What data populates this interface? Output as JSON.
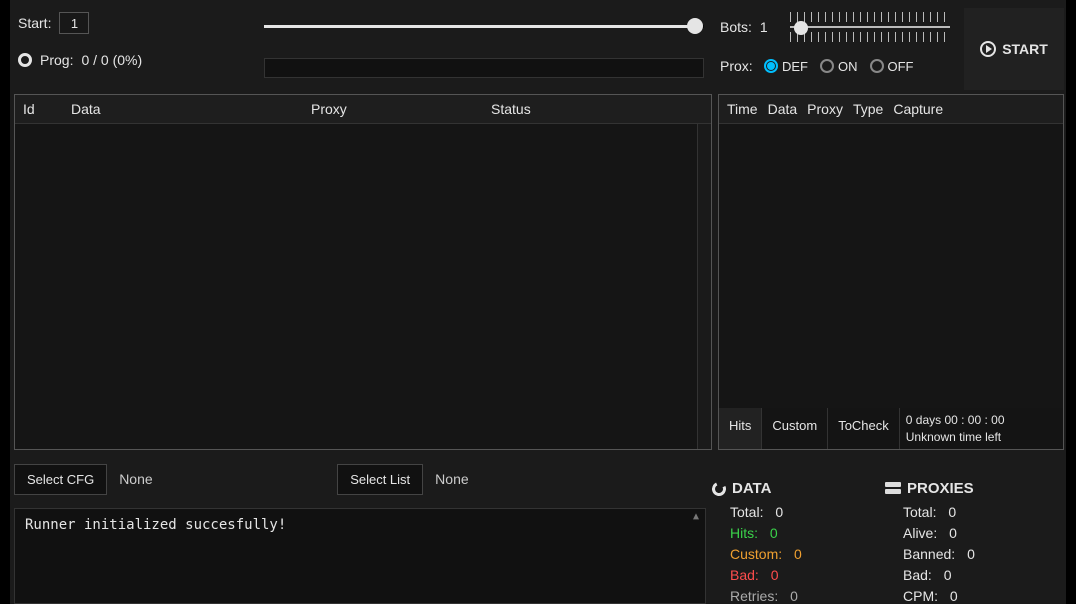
{
  "top": {
    "start_label": "Start:",
    "start_value": "1",
    "prog_label": "Prog:",
    "prog_text": "0 / 0 (0%)",
    "bots_label": "Bots:",
    "bots_value": "1",
    "prox_label": "Prox:",
    "prox_options": {
      "def": "DEF",
      "on": "ON",
      "off": "OFF"
    },
    "prox_selected": "DEF",
    "start_button": "START"
  },
  "left_table": {
    "headers": {
      "id": "Id",
      "data": "Data",
      "proxy": "Proxy",
      "status": "Status"
    },
    "rows": []
  },
  "right_table": {
    "headers": {
      "time": "Time",
      "data": "Data",
      "proxy": "Proxy",
      "type": "Type",
      "capture": "Capture"
    },
    "rows": []
  },
  "tabs": {
    "hits": "Hits",
    "custom": "Custom",
    "tocheck": "ToCheck",
    "timer_line1": "0  days  00 : 00 : 00",
    "timer_line2": "Unknown time left"
  },
  "cfg": {
    "select_cfg_btn": "Select CFG",
    "cfg_value": "None",
    "select_list_btn": "Select List",
    "list_value": "None"
  },
  "log": {
    "lines": [
      "Runner initialized succesfully!"
    ]
  },
  "stats": {
    "data_header": "DATA",
    "proxies_header": "PROXIES",
    "data": {
      "total": {
        "label": "Total:",
        "value": "0",
        "color": "c-white"
      },
      "hits": {
        "label": "Hits:",
        "value": "0",
        "color": "c-green"
      },
      "custom": {
        "label": "Custom:",
        "value": "0",
        "color": "c-orange"
      },
      "bad": {
        "label": "Bad:",
        "value": "0",
        "color": "c-red"
      },
      "retries": {
        "label": "Retries:",
        "value": "0",
        "color": "c-grey"
      }
    },
    "proxies": {
      "total": {
        "label": "Total:",
        "value": "0"
      },
      "alive": {
        "label": "Alive:",
        "value": "0"
      },
      "banned": {
        "label": "Banned:",
        "value": "0"
      },
      "bad": {
        "label": "Bad:",
        "value": "0"
      },
      "cpm": {
        "label": "CPM:",
        "value": "0"
      }
    }
  }
}
